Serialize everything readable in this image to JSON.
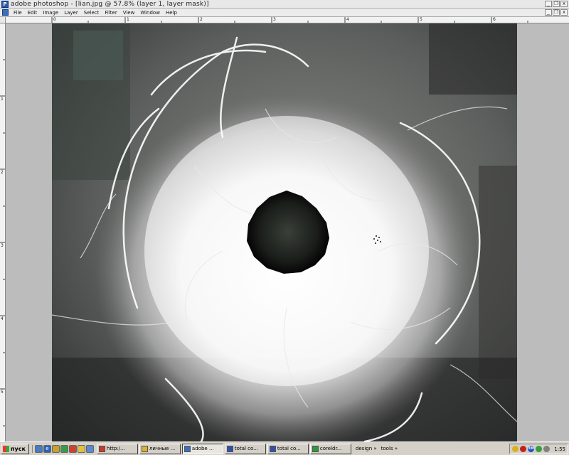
{
  "window": {
    "title": "adobe photoshop - [lian.jpg @ 57.8% (layer 1, layer mask)]",
    "controls": [
      "_",
      "❐",
      "x"
    ]
  },
  "menubar": {
    "items": [
      "File",
      "Edit",
      "Image",
      "Layer",
      "Select",
      "Filter",
      "View",
      "Window",
      "Help"
    ]
  },
  "ruler": {
    "top_labels": [
      "0",
      "1",
      "2",
      "3",
      "4",
      "5",
      "6"
    ],
    "left_labels": [
      "1",
      "2",
      "3",
      "4",
      "5"
    ]
  },
  "taskbar": {
    "start_label": "пуск",
    "tasks": [
      {
        "label": "http:/...",
        "icon": "browser-icon",
        "color": "#c83a2a"
      },
      {
        "label": "личные ...",
        "icon": "folder-icon",
        "color": "#e0b030"
      },
      {
        "label": "adobe ...",
        "icon": "photoshop-icon",
        "color": "#3a6ec0",
        "active": true
      },
      {
        "label": "total co...",
        "icon": "total-commander-icon",
        "color": "#3050b0"
      },
      {
        "label": "total co...",
        "icon": "total-commander-icon",
        "color": "#3050b0"
      },
      {
        "label": "coreldr...",
        "icon": "coreldraw-icon",
        "color": "#2a9a3a"
      }
    ],
    "bands": [
      "design »",
      "tools »"
    ],
    "tray_icons": [
      "update-icon",
      "antivirus-icon",
      "language-icon",
      "network-icon",
      "volume-icon"
    ],
    "language": "EN",
    "clock": "1:55"
  },
  "colors": {
    "accent": "#3a6ec0",
    "taskbar": "#d4d0c8"
  }
}
